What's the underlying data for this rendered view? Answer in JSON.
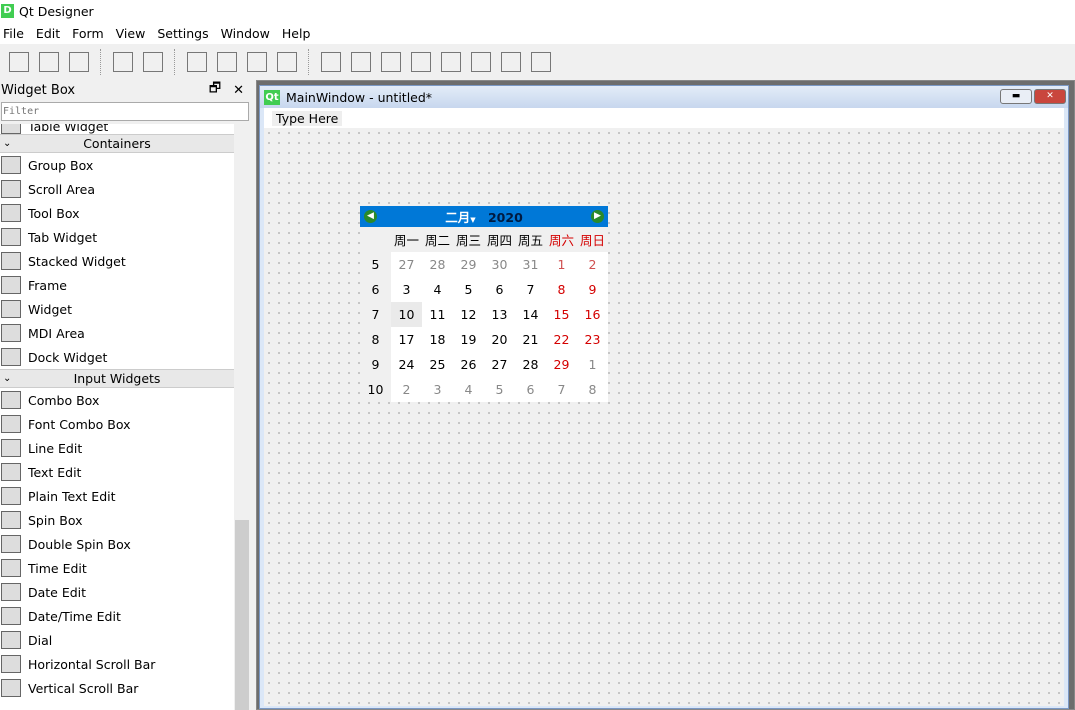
{
  "app": {
    "title": "Qt Designer",
    "icon": "D"
  },
  "menus": [
    "File",
    "Edit",
    "Form",
    "View",
    "Settings",
    "Window",
    "Help"
  ],
  "toolbar": [
    "new-icon",
    "open-icon",
    "save-icon",
    "send-to-back-icon",
    "bring-to-front-icon",
    "edit-widgets-icon",
    "edit-signals-slots-icon",
    "edit-buddies-icon",
    "edit-tab-order-icon",
    "layout-horizontal-icon",
    "layout-vertical-icon",
    "layout-h-splitter-icon",
    "layout-v-splitter-icon",
    "layout-grid-icon",
    "layout-form-icon",
    "break-layout-icon",
    "adjust-size-icon"
  ],
  "widget_box": {
    "title": "Widget Box",
    "filter_placeholder": "Filter",
    "partial_item": "Table Widget",
    "categories": [
      {
        "name": "Containers",
        "items": [
          "Group Box",
          "Scroll Area",
          "Tool Box",
          "Tab Widget",
          "Stacked Widget",
          "Frame",
          "Widget",
          "MDI Area",
          "Dock Widget"
        ]
      },
      {
        "name": "Input Widgets",
        "items": [
          "Combo Box",
          "Font Combo Box",
          "Line Edit",
          "Text Edit",
          "Plain Text Edit",
          "Spin Box",
          "Double Spin Box",
          "Time Edit",
          "Date Edit",
          "Date/Time Edit",
          "Dial",
          "Horizontal Scroll Bar",
          "Vertical Scroll Bar"
        ]
      }
    ]
  },
  "form": {
    "title": "MainWindow - untitled*",
    "menu_placeholder": "Type Here",
    "calendar": {
      "month": "二月",
      "year": "2020",
      "selected": "10",
      "headers": [
        "周一",
        "周二",
        "周三",
        "周四",
        "周五",
        "周六",
        "周日"
      ],
      "weeks": [
        {
          "n": "5",
          "days": [
            "27",
            "28",
            "29",
            "30",
            "31",
            "1",
            "2"
          ],
          "cls": [
            "grey",
            "grey",
            "grey",
            "grey",
            "grey",
            "redl",
            "redl"
          ]
        },
        {
          "n": "6",
          "days": [
            "3",
            "4",
            "5",
            "6",
            "7",
            "8",
            "9"
          ],
          "cls": [
            "",
            "",
            "",
            "",
            "",
            "red",
            "red"
          ]
        },
        {
          "n": "7",
          "days": [
            "10",
            "11",
            "12",
            "13",
            "14",
            "15",
            "16"
          ],
          "cls": [
            "sel",
            "",
            "",
            "",
            "",
            "red",
            "red"
          ]
        },
        {
          "n": "8",
          "days": [
            "17",
            "18",
            "19",
            "20",
            "21",
            "22",
            "23"
          ],
          "cls": [
            "",
            "",
            "",
            "",
            "",
            "red",
            "red"
          ]
        },
        {
          "n": "9",
          "days": [
            "24",
            "25",
            "26",
            "27",
            "28",
            "29",
            "1"
          ],
          "cls": [
            "",
            "",
            "",
            "",
            "",
            "red",
            "grey"
          ]
        },
        {
          "n": "10",
          "days": [
            "2",
            "3",
            "4",
            "5",
            "6",
            "7",
            "8"
          ],
          "cls": [
            "grey",
            "grey",
            "grey",
            "grey",
            "grey",
            "grey",
            "grey"
          ]
        }
      ]
    }
  },
  "colors": {
    "calendar_nav": "#0078d7",
    "weekend": "#d40000"
  }
}
